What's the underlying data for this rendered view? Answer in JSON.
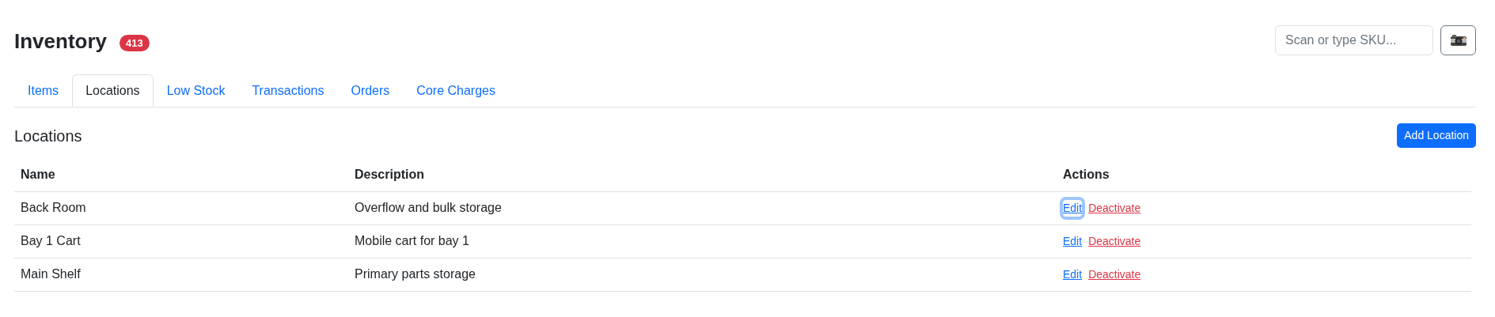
{
  "header": {
    "title": "Inventory",
    "badge": "413",
    "search": {
      "placeholder": "Scan or type SKU..."
    }
  },
  "tabs": [
    {
      "label": "Items",
      "selected": false
    },
    {
      "label": "Locations",
      "selected": true
    },
    {
      "label": "Low Stock",
      "selected": false
    },
    {
      "label": "Transactions",
      "selected": false
    },
    {
      "label": "Orders",
      "selected": false
    },
    {
      "label": "Core Charges",
      "selected": false
    }
  ],
  "section": {
    "title": "Locations",
    "add_button": "Add Location"
  },
  "table": {
    "columns": [
      "Name",
      "Description",
      "Actions"
    ],
    "rows": [
      {
        "name": "Back Room",
        "description": "Overflow and bulk storage",
        "edit": "Edit",
        "deactivate": "Deactivate",
        "edit_focused": true
      },
      {
        "name": "Bay 1 Cart",
        "description": "Mobile cart for bay 1",
        "edit": "Edit",
        "deactivate": "Deactivate",
        "edit_focused": false
      },
      {
        "name": "Main Shelf",
        "description": "Primary parts storage",
        "edit": "Edit",
        "deactivate": "Deactivate",
        "edit_focused": false
      }
    ]
  }
}
